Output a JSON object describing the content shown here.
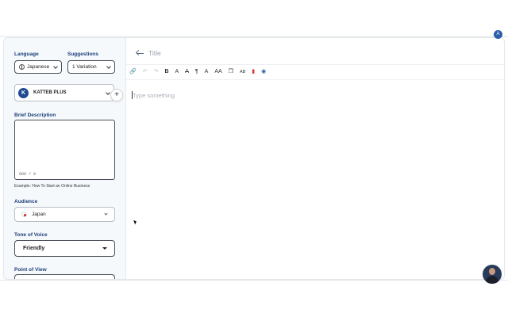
{
  "sidebar": {
    "language_label": "Language",
    "language_value": "Japanese",
    "suggestions_label": "Suggestions",
    "suggestions_value": "1 Variation",
    "model_badge": "K",
    "model_name": "KATTEB PLUS",
    "add_label": "+",
    "brief_label": "Brief Description",
    "brief_value": "",
    "counter": "600 / 0",
    "example": "Example: How To Start an Online Business",
    "audience_label": "Audience",
    "audience_value": "Japan",
    "tone_label": "Tone of Voice",
    "tone_value": "Friendly",
    "pov_label": "Point of View"
  },
  "editor": {
    "title_placeholder": "Title",
    "body_placeholder": "Type something",
    "toolbar": {
      "link": "🔗",
      "undo": "↶",
      "redo": "↷",
      "bold": "B",
      "font_color": "A",
      "clear_format": "A",
      "paragraph": "¶",
      "font_size": "A",
      "text_case": "AA",
      "copy": "❐",
      "spellcheck": "AB",
      "export": "▮",
      "ai": "◉"
    }
  },
  "float_icon": "A"
}
